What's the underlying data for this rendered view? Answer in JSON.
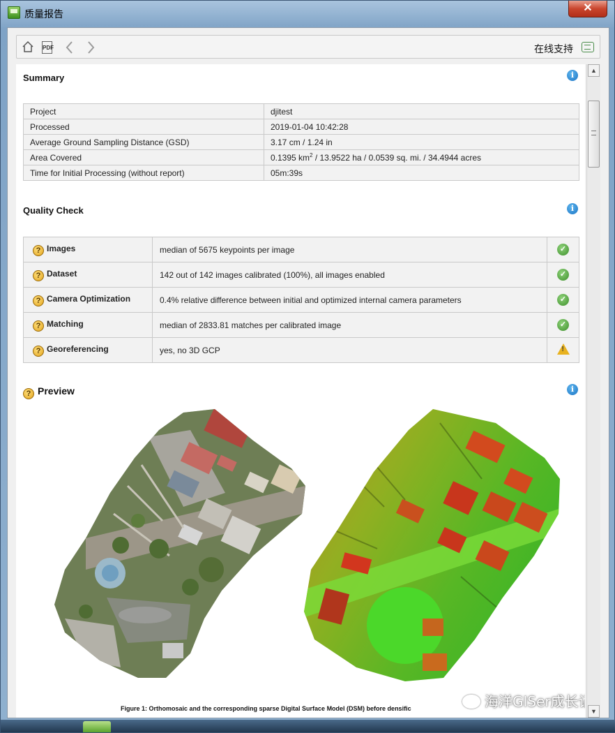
{
  "window": {
    "title": "质量报告",
    "close_symbol": "✕"
  },
  "toolbar": {
    "home_icon": "home-icon",
    "pdf_label": "PDF",
    "back_icon": "chevron-left-icon",
    "forward_icon": "chevron-right-icon",
    "support_label": "在线支持",
    "support_icon": "chat-bubble-icon"
  },
  "summary": {
    "title": "Summary",
    "rows": [
      {
        "key": "Project",
        "value": "djitest"
      },
      {
        "key": "Processed",
        "value": "2019-01-04 10:42:28"
      },
      {
        "key": "Average Ground Sampling Distance (GSD)",
        "value": "3.17 cm / 1.24 in"
      },
      {
        "key": "Area Covered",
        "value_pre": "0.1395 km",
        "value_sup": "2",
        "value_post": " / 13.9522 ha / 0.0539 sq. mi. / 34.4944 acres"
      },
      {
        "key": "Time for Initial Processing (without report)",
        "value": "05m:39s"
      }
    ]
  },
  "quality_check": {
    "title": "Quality Check",
    "rows": [
      {
        "name": "Images",
        "detail": "median of 5675 keypoints per image",
        "status": "ok"
      },
      {
        "name": "Dataset",
        "detail": "142 out of 142 images calibrated (100%), all images enabled",
        "status": "ok"
      },
      {
        "name": "Camera Optimization",
        "detail": "0.4% relative difference between initial and optimized internal camera parameters",
        "status": "ok"
      },
      {
        "name": "Matching",
        "detail": "median of 2833.81 matches per calibrated image",
        "status": "ok"
      },
      {
        "name": "Georeferencing",
        "detail": "yes, no 3D GCP",
        "status": "warning"
      }
    ]
  },
  "preview": {
    "title": "Preview",
    "caption": "Figure 1: Orthomosaic and the corresponding sparse Digital Surface Model (DSM) before densific"
  },
  "watermark": "海洋GISer成长记",
  "colors": {
    "ok": "#3d8f2b",
    "warning": "#e8b21f",
    "info": "#1a74c4",
    "help": "#e2a31e"
  }
}
